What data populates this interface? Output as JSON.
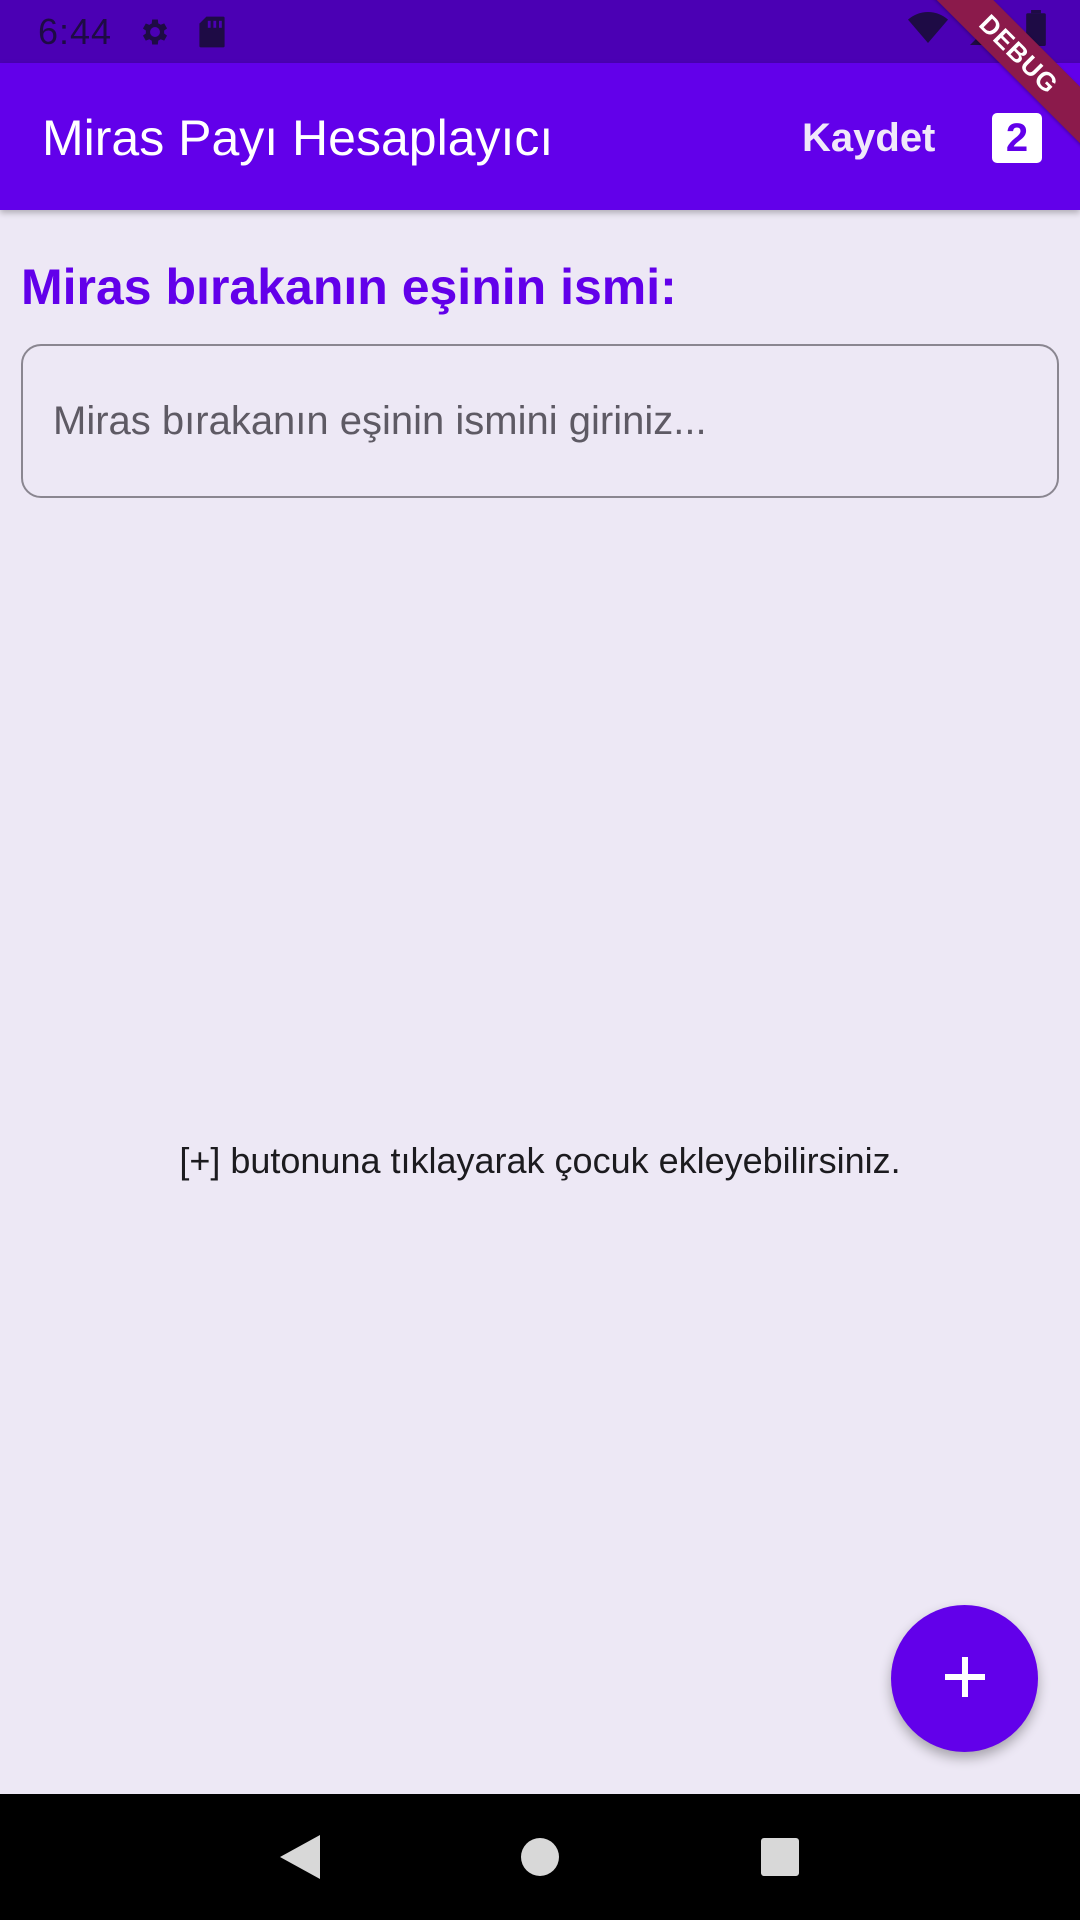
{
  "status_bar": {
    "time": "6:44",
    "icons": [
      "settings-icon",
      "sd-card-icon",
      "wifi-icon",
      "signal-icon",
      "battery-icon"
    ]
  },
  "app_bar": {
    "title": "Miras Payı Hesaplayıcı",
    "save_label": "Kaydet",
    "count_badge": "2"
  },
  "debug_banner": "DEBUG",
  "form": {
    "heading": "Miras bırakanın eşinin ismi:",
    "spouse_name_value": "",
    "spouse_name_placeholder": "Miras bırakanın eşinin ismini giriniz..."
  },
  "empty_hint": "[+] butonuna tıklayarak çocuk ekleyebilirsiniz.",
  "fab_icon": "plus-icon",
  "nav_bar": [
    "back-icon",
    "home-icon",
    "recents-icon"
  ],
  "colors": {
    "primary": "#6200ea",
    "status_bar": "#4b00b4",
    "background": "#ede8f5",
    "debug_ribbon": "#8b1a4b"
  }
}
